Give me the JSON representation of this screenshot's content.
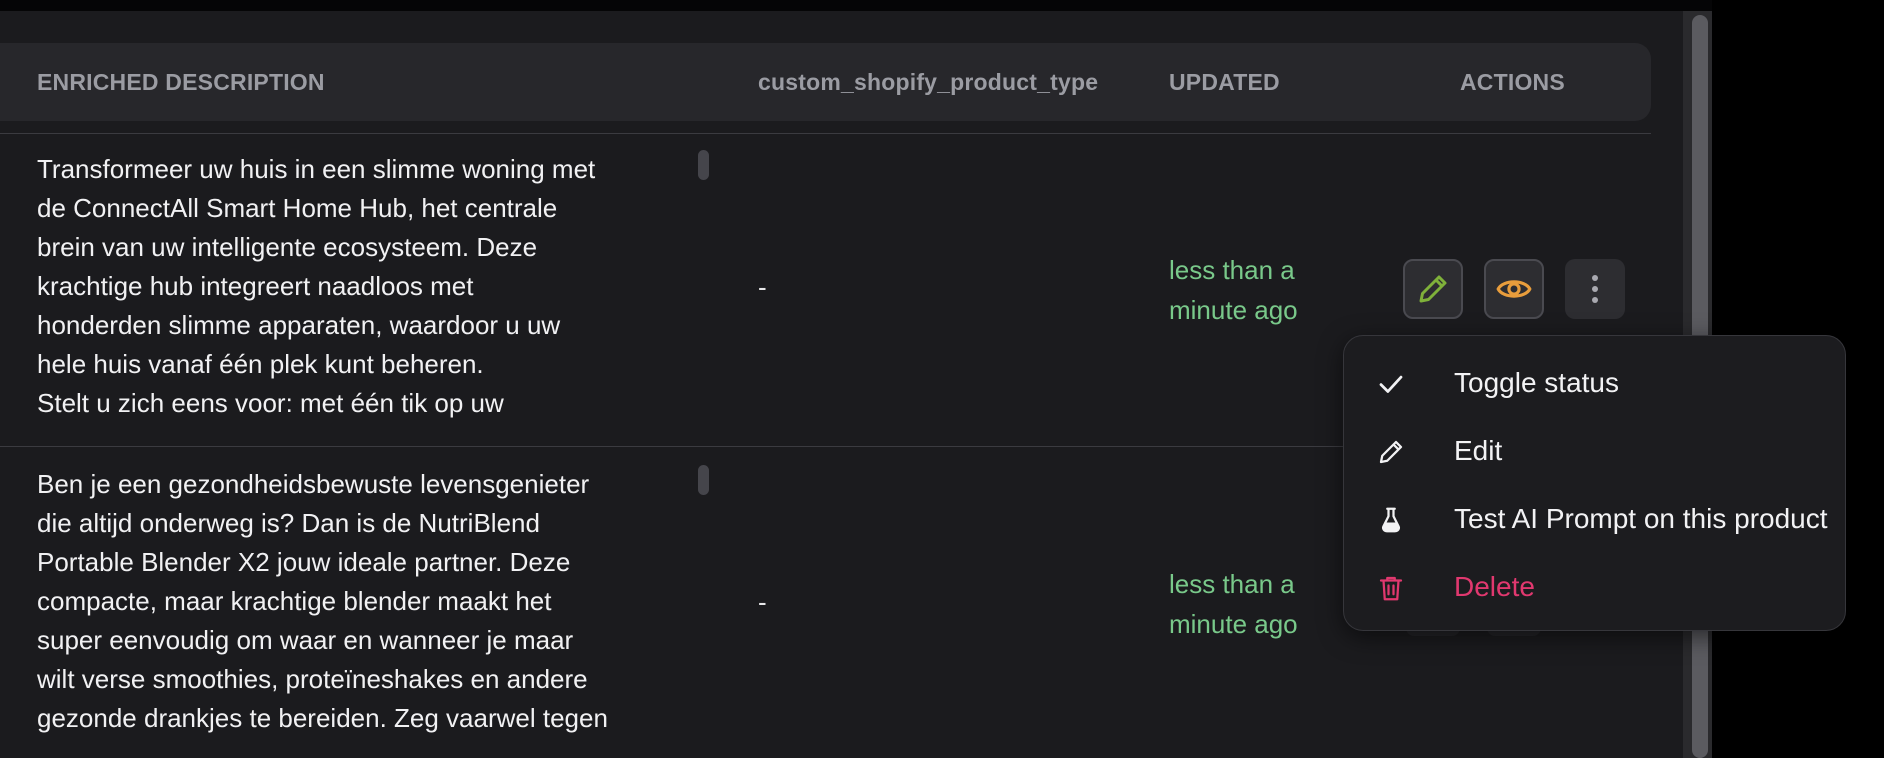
{
  "table": {
    "headers": {
      "enriched_description": "ENRICHED DESCRIPTION",
      "custom_type": "custom_shopify_product_type",
      "updated": "UPDATED",
      "actions": "ACTIONS"
    },
    "rows": [
      {
        "description_lines": [
          "Transformeer uw huis in een slimme woning met",
          "de ConnectAll Smart Home Hub, het centrale",
          "brein van uw intelligente ecosysteem. Deze",
          "krachtige hub integreert naadloos met",
          "honderden slimme apparaten, waardoor u uw",
          "hele huis vanaf één plek kunt beheren.",
          "Stelt u zich eens voor: met één tik op uw"
        ],
        "custom_type": "-",
        "updated_line1": "less than a",
        "updated_line2": "minute ago"
      },
      {
        "description_lines": [
          "Ben je een gezondheidsbewuste levensgenieter",
          "die altijd onderweg is? Dan is de NutriBlend",
          "Portable Blender X2 jouw ideale partner. Deze",
          "compacte, maar krachtige blender maakt het",
          "super eenvoudig om waar en wanneer je maar",
          "wilt verse smoothies, proteïneshakes en andere",
          "gezonde drankjes te bereiden. Zeg vaarwel tegen"
        ],
        "custom_type": "-",
        "updated_line1": "less than a",
        "updated_line2": "minute ago"
      }
    ]
  },
  "actions": {
    "edit_icon": "pencil-icon",
    "view_icon": "eye-icon",
    "more_icon": "vertical-dots-icon"
  },
  "menu": {
    "items": [
      {
        "label": "Toggle status",
        "icon": "check-icon"
      },
      {
        "label": "Edit",
        "icon": "pencil-icon"
      },
      {
        "label": "Test AI Prompt on this product",
        "icon": "flask-icon"
      },
      {
        "label": "Delete",
        "icon": "trash-icon"
      }
    ]
  },
  "colors": {
    "background": "#1b1b1e",
    "header_bg": "#27272b",
    "updated_text": "#79c98a",
    "edit_accent": "#7fb13a",
    "view_accent": "#e89d3c",
    "danger": "#e1386f"
  }
}
